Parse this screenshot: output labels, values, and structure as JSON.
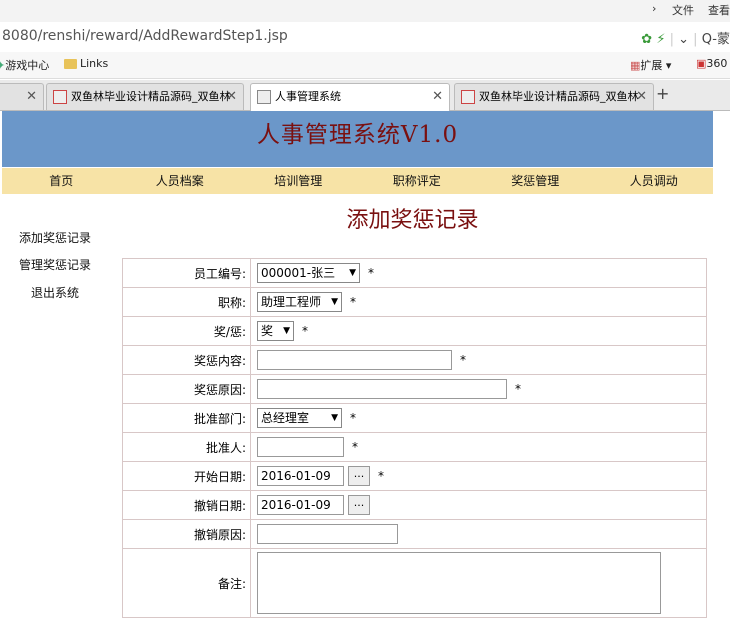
{
  "browser": {
    "top_right": [
      "文件",
      "查看"
    ],
    "url": "8080/renshi/reward/AddRewardStep1.jsp",
    "search_hint": "Q-蒙",
    "bookmarks": [
      "游戏中心",
      "Links"
    ],
    "extensions_label": "扩展",
    "ext_count": "360",
    "tabs": [
      {
        "label": ""
      },
      {
        "label": "双鱼林毕业设计精品源码_双鱼林"
      },
      {
        "label": "人事管理系统"
      },
      {
        "label": "双鱼林毕业设计精品源码_双鱼林"
      }
    ],
    "new_tab": "+"
  },
  "app": {
    "title": "人事管理系统V1.0",
    "nav": [
      "首页",
      "人员档案",
      "培训管理",
      "职称评定",
      "奖惩管理",
      "人员调动"
    ],
    "sidebar": [
      "添加奖惩记录",
      "管理奖惩记录",
      "退出系统"
    ]
  },
  "form": {
    "page_title": "添加奖惩记录",
    "required_mark": "*",
    "date_button": "...",
    "fields": {
      "employee": {
        "label": "员工编号:",
        "value": "000001-张三"
      },
      "position": {
        "label": "职称:",
        "value": "助理工程师"
      },
      "type": {
        "label": "奖/惩:",
        "value": "奖"
      },
      "content": {
        "label": "奖惩内容:",
        "value": ""
      },
      "reason": {
        "label": "奖惩原因:",
        "value": ""
      },
      "dept": {
        "label": "批准部门:",
        "value": "总经理室"
      },
      "approver": {
        "label": "批准人:",
        "value": ""
      },
      "start_date": {
        "label": "开始日期:",
        "value": "2016-01-09"
      },
      "revoke_date": {
        "label": "撤销日期:",
        "value": "2016-01-09"
      },
      "revoke_reason": {
        "label": "撤销原因:",
        "value": ""
      },
      "remark": {
        "label": "备注:",
        "value": ""
      }
    }
  }
}
